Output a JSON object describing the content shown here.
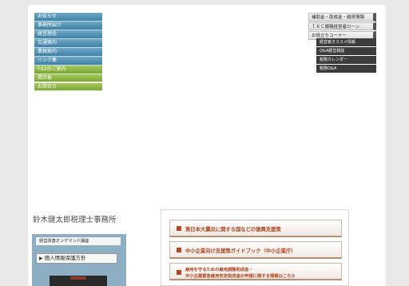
{
  "left_nav": {
    "items": [
      {
        "label": "お知らせ",
        "color": "blue"
      },
      {
        "label": "事務所紹介",
        "color": "blue"
      },
      {
        "label": "経営理念",
        "color": "blue"
      },
      {
        "label": "交通案内",
        "color": "blue"
      },
      {
        "label": "業務案内",
        "color": "blue"
      },
      {
        "label": "リンク集",
        "color": "blue"
      },
      {
        "label": "FX2のご案内",
        "color": "green"
      },
      {
        "label": "掲示板",
        "color": "green"
      },
      {
        "label": "お問合せ",
        "color": "green"
      }
    ]
  },
  "right_menu": {
    "items": [
      {
        "label": "補助金・助成金・融資情報"
      },
      {
        "label": "ＴＫＣ戦略経営者ローン"
      },
      {
        "label": "お役立ちコーナー"
      }
    ],
    "submenu": [
      {
        "label": "経営者オススメ情報"
      },
      {
        "label": "Q&A経営相談"
      },
      {
        "label": "税務カレンダー"
      },
      {
        "label": "税務Q&A"
      }
    ]
  },
  "office_name": "鈴木健太郎税理士事務所",
  "left_box": {
    "header": "経営改善オンデマンド講座",
    "button": "個人情報保護方針"
  },
  "right_box": {
    "buttons": [
      {
        "label": "東日本大震災に関する国などの復興支援策"
      },
      {
        "label": "中小企業向け支援策ガイドブック（中小企業庁）"
      },
      {
        "line1": "雇用を守るための雇用調整助成金・",
        "line2": "中小企業緊急雇用安定助成金の申請に関する情報はこちら"
      }
    ]
  },
  "colors": {
    "nav_blue": "#4f8fb3",
    "nav_green": "#8cb84a",
    "accent_red": "#b2441f",
    "submenu_dark": "#3c3c3c",
    "left_box_bg": "#8cafc3"
  }
}
